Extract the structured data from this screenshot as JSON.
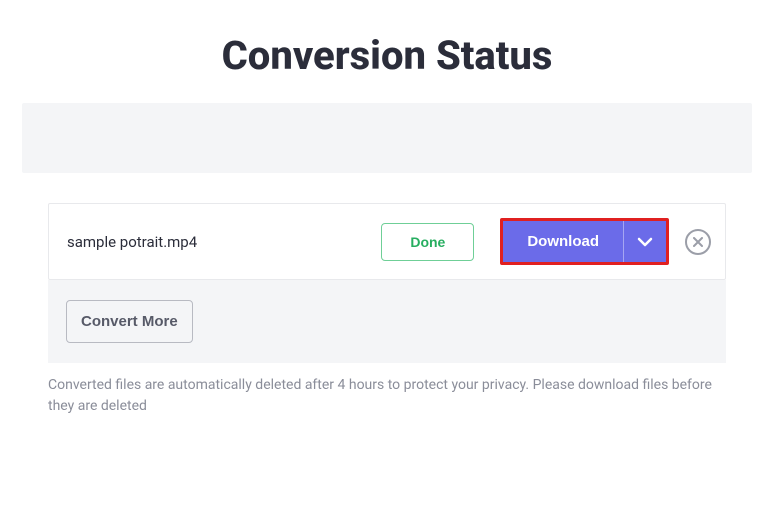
{
  "title": "Conversion Status",
  "file": {
    "name": "sample potrait.mp4",
    "status_label": "Done",
    "download_label": "Download"
  },
  "convert_more_label": "Convert More",
  "note": "Converted files are automatically deleted after 4 hours to protect your privacy. Please download files before they are deleted"
}
